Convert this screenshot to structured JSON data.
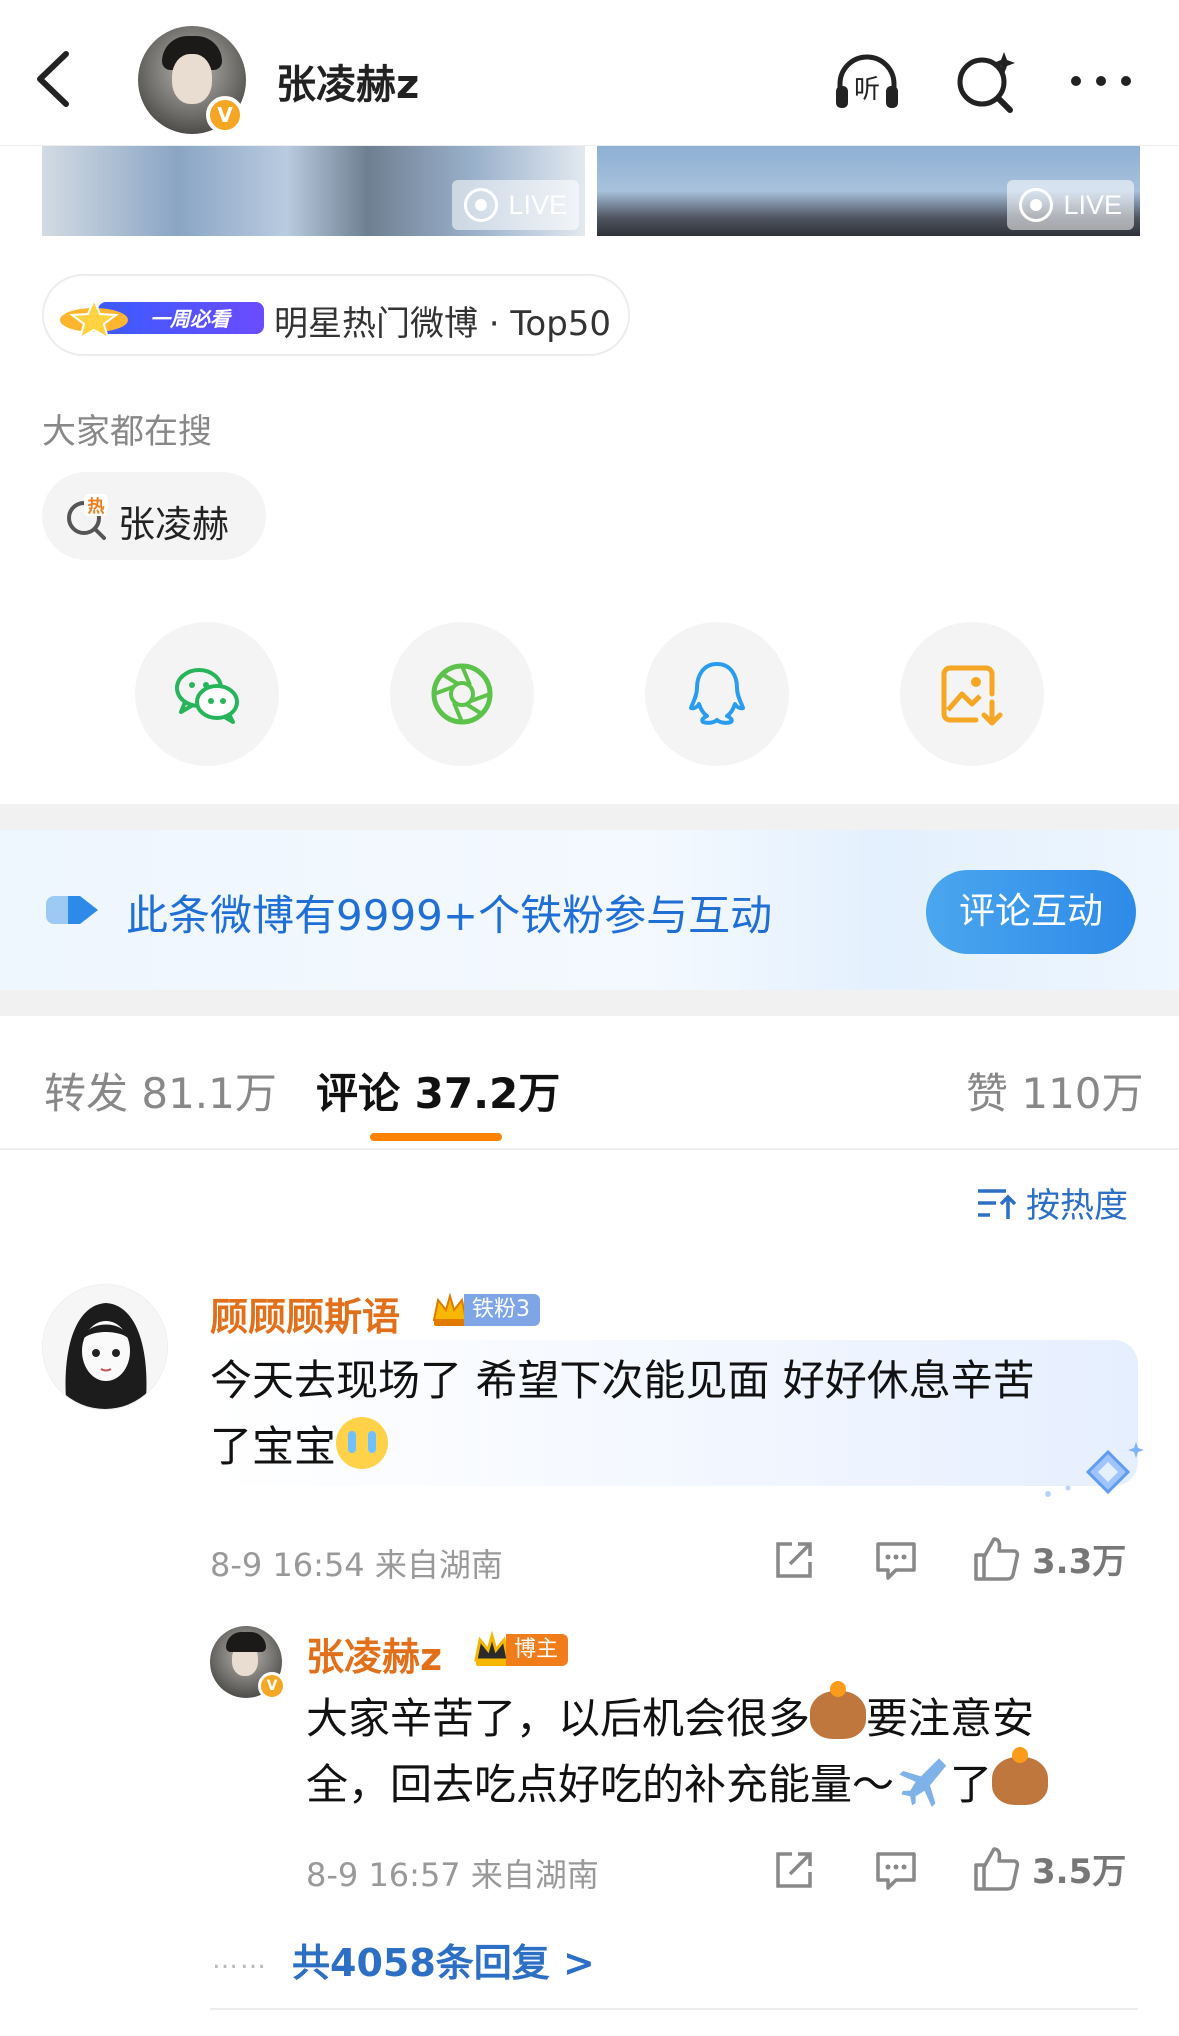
{
  "header": {
    "author_name": "张凌赫z",
    "verified_mark": "V",
    "icons": [
      "back-arrow-icon",
      "listen-icon",
      "search-sparkle-icon",
      "more-dots-icon"
    ],
    "listen_label": "听"
  },
  "photos": [
    {
      "live_label": "LIVE"
    },
    {
      "live_label": "LIVE"
    }
  ],
  "hot_tag": {
    "badge_label": "一周必看",
    "text": "明星热门微博 · Top50"
  },
  "search": {
    "title": "大家都在搜",
    "hot_mark": "热",
    "chip_text": "张凌赫"
  },
  "share": {
    "items": [
      "wechat-icon",
      "moments-icon",
      "qq-icon",
      "save-image-icon"
    ]
  },
  "fan_banner": {
    "text": "此条微博有9999+个铁粉参与互动",
    "button_label": "评论互动"
  },
  "tabs": {
    "repost": "转发 81.1万",
    "comments": "评论 37.2万",
    "likes": "赞 110万",
    "active": "comments"
  },
  "sort_label": "按热度",
  "comments": [
    {
      "user": "顾顾顾斯语",
      "badge": "铁粉3",
      "text_line1": "今天去现场了 希望下次能见面 好好休息辛苦",
      "text_line2": "了宝宝",
      "emoji": "loudly-crying-emoji",
      "meta": "8-9 16:54 来自湖南",
      "likes": "3.3万",
      "reply": {
        "user": "张凌赫z",
        "badge": "博主",
        "verified_mark": "V",
        "text_part1": "大家辛苦了，以后机会很多",
        "text_part2": "要注意安",
        "text_part3": "全，回去吃点好吃的补充能量～",
        "text_part4": "了",
        "meta": "8-9 16:57 来自湖南",
        "likes": "3.5万"
      },
      "more_replies_dots": "……",
      "more_replies": "共4058条回复 >"
    }
  ],
  "colors": {
    "accent_orange": "#ff8200",
    "link_blue": "#2c6fc4",
    "name_orange": "#e2701a",
    "banner_blue": "#1f6fd6"
  }
}
